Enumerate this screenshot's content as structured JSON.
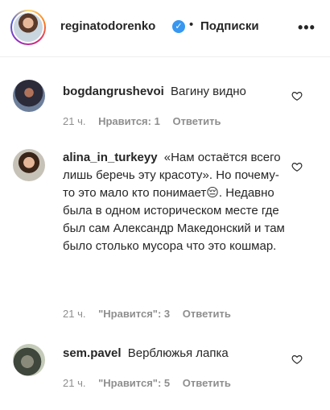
{
  "header": {
    "username": "reginatodorenko",
    "separator": "•",
    "follow_label": "Подписки",
    "verified_icon": "verified-badge-icon",
    "more_icon": "more-horizontal-icon"
  },
  "comments": [
    {
      "username": "bogdangrushevoi",
      "text": "Вагину видно",
      "time": "21 ч.",
      "likes": "Нравится: 1",
      "reply": "Ответить"
    },
    {
      "username": "alina_in_turkeyy",
      "text": "«Нам остаётся всего лишь беречь эту красоту». Но почему-то это мало кто понимает😔. Недавно была в одном историческом месте где был сам Александр Македонский и там было столько мусора что это кошмар.",
      "time": "21 ч.",
      "likes": "\"Нравится\": 3",
      "reply": "Ответить"
    },
    {
      "username": "sem.pavel",
      "text": "Верблюжья лапка",
      "time": "21 ч.",
      "likes": "\"Нравится\": 5",
      "reply": "Ответить"
    }
  ],
  "colors": {
    "text": "#262626",
    "meta": "#8e8e8e",
    "verified": "#3897f0"
  }
}
